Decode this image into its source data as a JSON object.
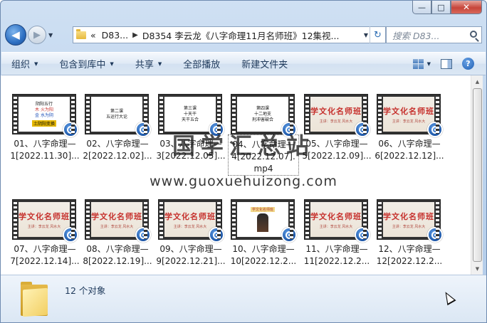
{
  "window": {
    "caption_buttons": {
      "minimize": "—",
      "maximize": "□",
      "close": "✕"
    }
  },
  "navigation": {
    "back_glyph": "◀",
    "forward_glyph": "▶",
    "breadcrumb_overflow": "«",
    "breadcrumb": [
      "D83...",
      "D8354 李云龙《八字命理11月名师班》12集视..."
    ],
    "search_placeholder": "搜索 D83...",
    "refresh_glyph": "↻"
  },
  "toolbar": {
    "items": [
      "组织",
      "包含到库中",
      "共享",
      "全部播放",
      "新建文件夹"
    ],
    "help_glyph": "?"
  },
  "files": [
    {
      "line1": "01、八字命理—",
      "line2": "1[2022.11.30]...",
      "thumb": "slide1",
      "slide": [
        "阴阳五行",
        "木 火为阳",
        "金 水为阴",
        "土阴阳变换"
      ]
    },
    {
      "line1": "02、八字命理—",
      "line2": "2[2022.12.02]...",
      "thumb": "slide",
      "slide": [
        "第二课",
        "五运行大论"
      ]
    },
    {
      "line1": "03、八字命理—",
      "line2": "3[2022.12.05]...",
      "thumb": "slide",
      "slide": [
        "第三课",
        "十天干",
        "天干五合"
      ]
    },
    {
      "line1": "04、八字命理—",
      "line2": "4[2022.12.07].",
      "line3": "mp4",
      "thumb": "slide",
      "slide": [
        "第四课",
        "十二地支",
        "刑冲害破合"
      ],
      "selected": true
    },
    {
      "line1": "05、八字命理—",
      "line2": "5[2022.12.09]...",
      "thumb": "banner"
    },
    {
      "line1": "06、八字命理—",
      "line2": "6[2022.12.12]...",
      "thumb": "banner"
    },
    {
      "line1": "07、八字命理—",
      "line2": "7[2022.12.14]...",
      "thumb": "banner"
    },
    {
      "line1": "08、八字命理—",
      "line2": "8[2022.12.19]...",
      "thumb": "banner"
    },
    {
      "line1": "09、八字命理—",
      "line2": "9[2022.12.21]...",
      "thumb": "banner"
    },
    {
      "line1": "10、八字命理—",
      "line2": "10[2022.12.2...",
      "thumb": "poster"
    },
    {
      "line1": "11、八字命理—",
      "line2": "11[2022.12.2...",
      "thumb": "banner"
    },
    {
      "line1": "12、八字命理—",
      "line2": "12[2022.12.2...",
      "thumb": "banner"
    }
  ],
  "thumb_banner": {
    "title": "学文化名师班",
    "subtitle": "主讲：李云龙  风水大"
  },
  "watermark": {
    "title": "国学汇总站",
    "url": "www.guoxuehuizong.com"
  },
  "details": {
    "count_text": "12 个对象"
  },
  "colors": {
    "accent": "#2d6fc2",
    "banner_red": "#c6312d",
    "close_red": "#c7453a"
  }
}
